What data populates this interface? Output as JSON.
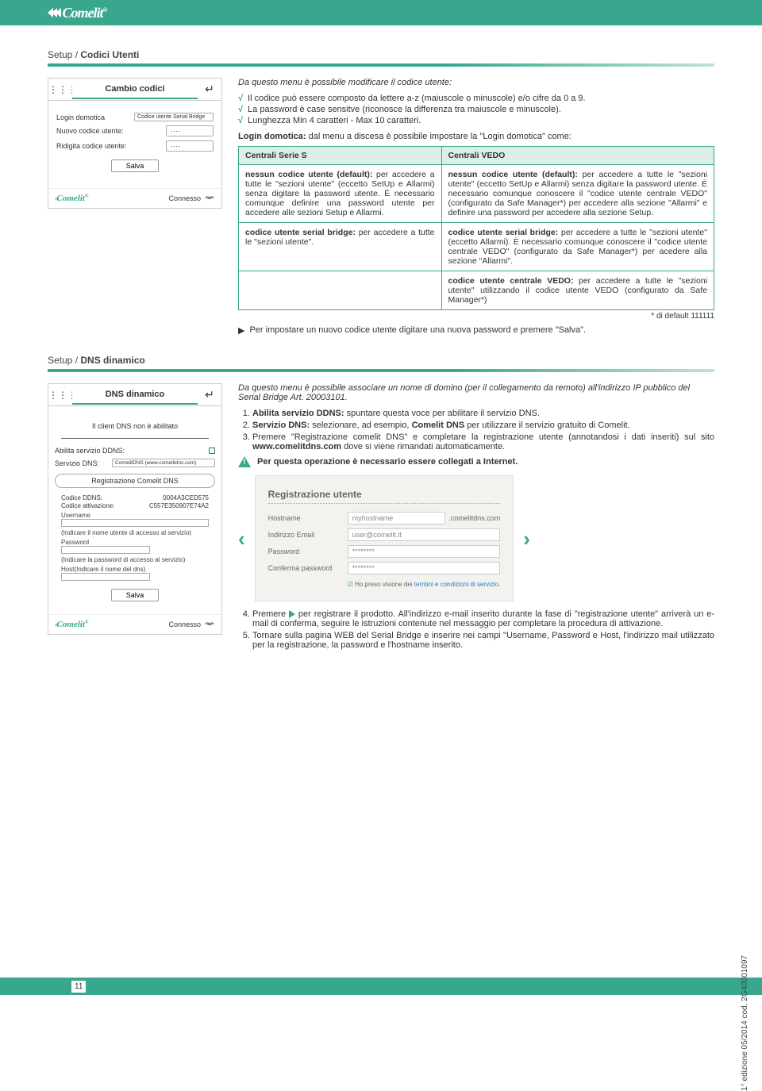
{
  "topbar": {
    "brand": "Comelit"
  },
  "section1": {
    "breadcrumb_a": "Setup / ",
    "breadcrumb_b": "Codici Utenti",
    "mockup": {
      "tab": "Cambio codici",
      "row1_label": "Login domotica",
      "row1_select": "Codice utente Serial Bridge",
      "row2_label": "Nuovo codice utente:",
      "row2_val": "····",
      "row3_label": "Ridigita codice utente:",
      "row3_val": "····",
      "save": "Salva",
      "footer_status": "Connesso"
    },
    "intro": "Da questo menu è possibile modificare il codice utente:",
    "check1": "Il codice può essere composto da lettere a-z (maiuscole o minuscole) e/o cifre da 0 a 9.",
    "check2": "La password è case sensitve (riconosce la differenza tra maiuscole e minuscole).",
    "check3": "Lunghezza Min 4 caratteri - Max 10 caratteri.",
    "login_line_a": "Login domotica:",
    "login_line_b": " dal menu a discesa è possibile impostare la \"Login domotica\" come:",
    "table": {
      "h1": "Centrali Serie S",
      "h2": "Centrali VEDO",
      "r1c1": "nessun codice utente (default): per accedere a tutte le \"sezioni utente\" (eccetto SetUp e Allarmi) senza digitare la password utente. È necessario comunque definire una password utente per accedere alle sezioni Setup e Allarmi.",
      "r1c2": "nessun codice utente (default): per accedere a tutte le \"sezioni utente\" (eccetto SetUp e Allarmi) senza digitare la password utente. È necessario comunque conoscere il \"codice utente centrale VEDO\" (configurato da Safe Manager*) per accedere alla sezione \"Allarmi\" e definire una password per accedere alla sezione Setup.",
      "r2c1": "codice utente serial bridge: per accedere a tutte le \"sezioni utente\".",
      "r2c2": "codice utente serial bridge: per accedere a tutte le \"sezioni utente\" (eccetto Allarmi). È necessario comunque conoscere il \"codice utente centrale VEDO\" (configurato da Safe Manager*) per acedere alla sezione \"Allarmi\".",
      "r3c2": "codice utente centrale VEDO: per accedere a tutte le \"sezioni utente\" utilizzando il codice utente VEDO (configurato da Safe Manager*)"
    },
    "note": "* di default 111111",
    "bullet": "Per impostare un nuovo codice utente digitare una nuova password e premere \"Salva\"."
  },
  "section2": {
    "breadcrumb_a": "Setup / ",
    "breadcrumb_b": "DNS dinamico",
    "mockup": {
      "tab": "DNS dinamico",
      "sub": "Il client DNS non è abilitato",
      "lbl_enable": "Abilita servizio DDNS:",
      "lbl_service": "Servizio DNS:",
      "service_sel": "ComelitDNS (www.comelitdns.com)",
      "reg_btn": "Registrazione Comelit DNS",
      "kv1a": "Codice DDNS:",
      "kv1b": "0004A3CED575",
      "kv2a": "Codice attivazione:",
      "kv2b": "C557E350907E74A2",
      "lbl_user": "Username",
      "help_user": "(Indicare il nome utente di accesso al servizio)",
      "lbl_pass": "Password",
      "help_pass": "(Indicare la password di accesso al servizio)",
      "lbl_host": "Host(Indicare il nome del dns)",
      "save": "Salva",
      "footer_status": "Connesso"
    },
    "intro": "Da questo menu è possibile associare un nome di domino (per il collegamento da remoto) all'indirizzo IP pubblico del Serial Bridge Art. 20003101.",
    "step1_a": "Abilita servizio DDNS:",
    "step1_b": " spuntare questa voce per abilitare il servizio DNS.",
    "step2_a": "Servizio DNS:",
    "step2_b": " selezionare, ad esempio, ",
    "step2_c": "Comelit DNS",
    "step2_d": " per utilizzare il servizio gratuito di Comelit.",
    "step3_a": "Premere \"Registrazione comelit DNS\" e completare la registrazione utente (annotandosi i dati inseriti) sul sito ",
    "step3_b": "www.comelitdns.com",
    "step3_c": " dove si viene rimandati automaticamente.",
    "warn": "Per questa operazione è necessario essere collegati a Internet.",
    "regbox": {
      "title": "Registrazione utente",
      "r1": "Hostname",
      "r1v": "myhostname",
      "r1suf": ".comelitdns.com",
      "r2": "Indirizzo Email",
      "r2v": "user@comelit.it",
      "r3": "Password",
      "r3v": "********",
      "r4": "Conferma password",
      "r4v": "********",
      "terms_a": "Ho preso visione dei ",
      "terms_b": "termini e condizioni di servizio."
    },
    "step4_a": "Premere ",
    "step4_b": " per registrare il prodotto. All'indirizzo e-mail inserito durante la fase di \"registrazione utente\" arriverà un e-mail di conferma, seguire le istruzioni contenute nel messaggio per completare la procedura di attivazione.",
    "step5": "Tornare sulla pagina WEB del Serial Bridge e inserire nei campi \"Username, Password e Host, l'indirizzo mail utilizzato per la registrazione, la password e l'hostname inserito."
  },
  "side": "1° edizione 05/2014 cod. 2G40001097",
  "pagenum": "11"
}
